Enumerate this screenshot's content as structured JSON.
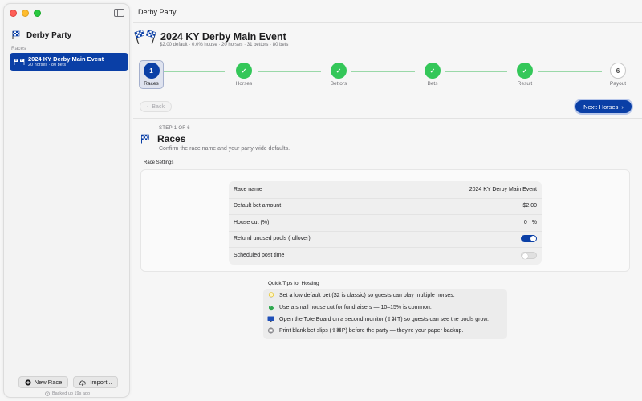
{
  "app": {
    "name": "Derby Party",
    "window_title": "Derby Party"
  },
  "sidebar": {
    "section_label": "Races",
    "races": [
      {
        "title": "2024 KY Derby Main Event",
        "subtitle": "20 horses · 80 bets"
      }
    ],
    "new_race_label": "New Race",
    "import_label": "Import...",
    "backup_status": "Backed up 19s ago"
  },
  "race": {
    "title": "2024 KY Derby Main Event",
    "summary": "$2.00 default  ·  0.0% house  ·  20 horses · 31 bettors · 80 bets"
  },
  "steps": [
    {
      "number": "1",
      "label": "Races",
      "state": "active"
    },
    {
      "number": "2",
      "label": "Horses",
      "state": "done"
    },
    {
      "number": "3",
      "label": "Bettors",
      "state": "done"
    },
    {
      "number": "4",
      "label": "Bets",
      "state": "done"
    },
    {
      "number": "5",
      "label": "Result",
      "state": "done"
    },
    {
      "number": "6",
      "label": "Payout",
      "state": "todo"
    }
  ],
  "nav": {
    "back_label": "Back",
    "next_label": "Next: Horses"
  },
  "section": {
    "step_of": "STEP 1 OF 6",
    "title": "Races",
    "description": "Confirm the race name and your party-wide defaults.",
    "settings_label": "Race Settings"
  },
  "settings": {
    "race_name_label": "Race name",
    "race_name_value": "2024 KY Derby Main Event",
    "default_bet_label": "Default bet amount",
    "default_bet_value": "$2.00",
    "house_cut_label": "House cut (%)",
    "house_cut_value": "0",
    "house_cut_unit": "%",
    "refund_label": "Refund unused pools (rollover)",
    "refund_on": true,
    "post_time_label": "Scheduled post time",
    "post_time_on": false
  },
  "tips": {
    "title": "Quick Tips for Hosting",
    "items": [
      {
        "icon": "lightbulb-icon",
        "text": "Set a low default bet ($2 is classic) so guests can play multiple horses."
      },
      {
        "icon": "tag-icon",
        "text": "Use a small house cut for fundraisers — 10–15% is common."
      },
      {
        "icon": "monitor-icon",
        "text": "Open the Tote Board on a second monitor (⇧⌘T) so guests can see the pools grow."
      },
      {
        "icon": "printer-icon",
        "text": "Print blank bet slips (⇧⌘P) before the party — they're your paper backup."
      }
    ]
  },
  "colors": {
    "accent": "#0a3fa6",
    "success": "#34c759"
  }
}
